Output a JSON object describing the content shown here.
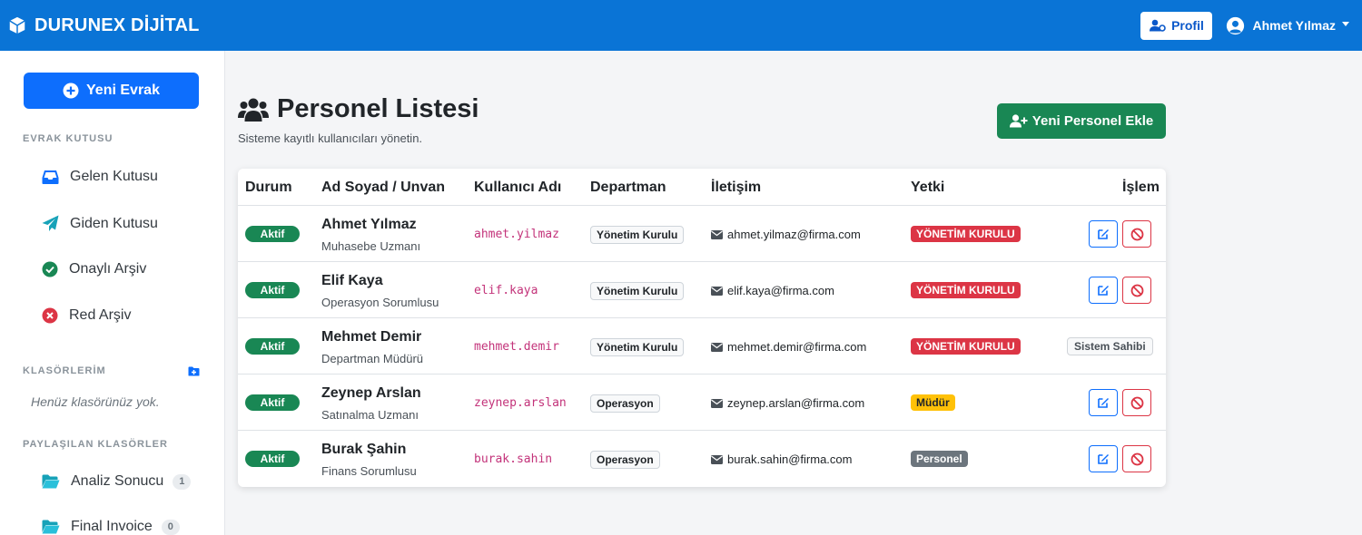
{
  "app": {
    "brand": "DURUNEX DİJİTAL"
  },
  "navbar": {
    "profile_label": "Profil",
    "user_name": "Ahmet Yılmaz"
  },
  "sidebar": {
    "new_doc_label": "Yeni Evrak",
    "inbox_section": "EVRAK KUTUSU",
    "items": [
      {
        "label": "Gelen Kutusu",
        "icon": "inbox-icon"
      },
      {
        "label": "Giden Kutusu",
        "icon": "paper-plane-icon"
      },
      {
        "label": "Onaylı Arşiv",
        "icon": "check-circle-icon"
      },
      {
        "label": "Red Arşiv",
        "icon": "x-circle-icon"
      }
    ],
    "folders_section": "KLASÖRLERİM",
    "folders_empty": "Henüz klasörünüz yok.",
    "shared_section": "PAYLAŞILAN KLASÖRLER",
    "shared_folders": [
      {
        "label": "Analiz Sonucu",
        "count": "1"
      },
      {
        "label": "Final Invoice",
        "count": "0"
      }
    ]
  },
  "main": {
    "title": "Personel Listesi",
    "subtitle": "Sisteme kayıtlı kullanıcıları yönetin.",
    "add_button": "Yeni Personel Ekle"
  },
  "table": {
    "headers": [
      "Durum",
      "Ad Soyad / Unvan",
      "Kullanıcı Adı",
      "Departman",
      "İletişim",
      "Yetki",
      "İşlem"
    ],
    "rows": [
      {
        "status": "Aktif",
        "name": "Ahmet Yılmaz",
        "title": "Muhasebe Uzmanı",
        "username": "ahmet.yilmaz",
        "department": "Yönetim Kurulu",
        "email": "ahmet.yilmaz@firma.com",
        "role": "YÖNETİM KURULU",
        "role_color": "#dc3545"
      },
      {
        "status": "Aktif",
        "name": "Elif Kaya",
        "title": "Operasyon Sorumlusu",
        "username": "elif.kaya",
        "department": "Yönetim Kurulu",
        "email": "elif.kaya@firma.com",
        "role": "YÖNETİM KURULU",
        "role_color": "#dc3545"
      },
      {
        "status": "Aktif",
        "name": "Mehmet Demir",
        "title": "Departman Müdürü",
        "username": "mehmet.demir",
        "department": "Yönetim Kurulu",
        "email": "mehmet.demir@firma.com",
        "role": "YÖNETİM KURULU",
        "role_color": "#dc3545",
        "action_label": "Sistem Sahibi"
      },
      {
        "status": "Aktif",
        "name": "Zeynep Arslan",
        "title": "Satınalma Uzmanı",
        "username": "zeynep.arslan",
        "department": "Operasyon",
        "email": "zeynep.arslan@firma.com",
        "role": "Müdür",
        "role_color": "#ffc107"
      },
      {
        "status": "Aktif",
        "name": "Burak Şahin",
        "title": "Finans Sorumlusu",
        "username": "burak.sahin",
        "department": "Operasyon",
        "email": "burak.sahin@firma.com",
        "role": "Personel",
        "role_color": "#6c757d"
      }
    ]
  },
  "colors": {
    "navbar": "#0a74d6",
    "primary": "#0d6efd",
    "success": "#198754",
    "danger": "#dc3545",
    "warning": "#ffc107",
    "secondary": "#6c757d"
  }
}
